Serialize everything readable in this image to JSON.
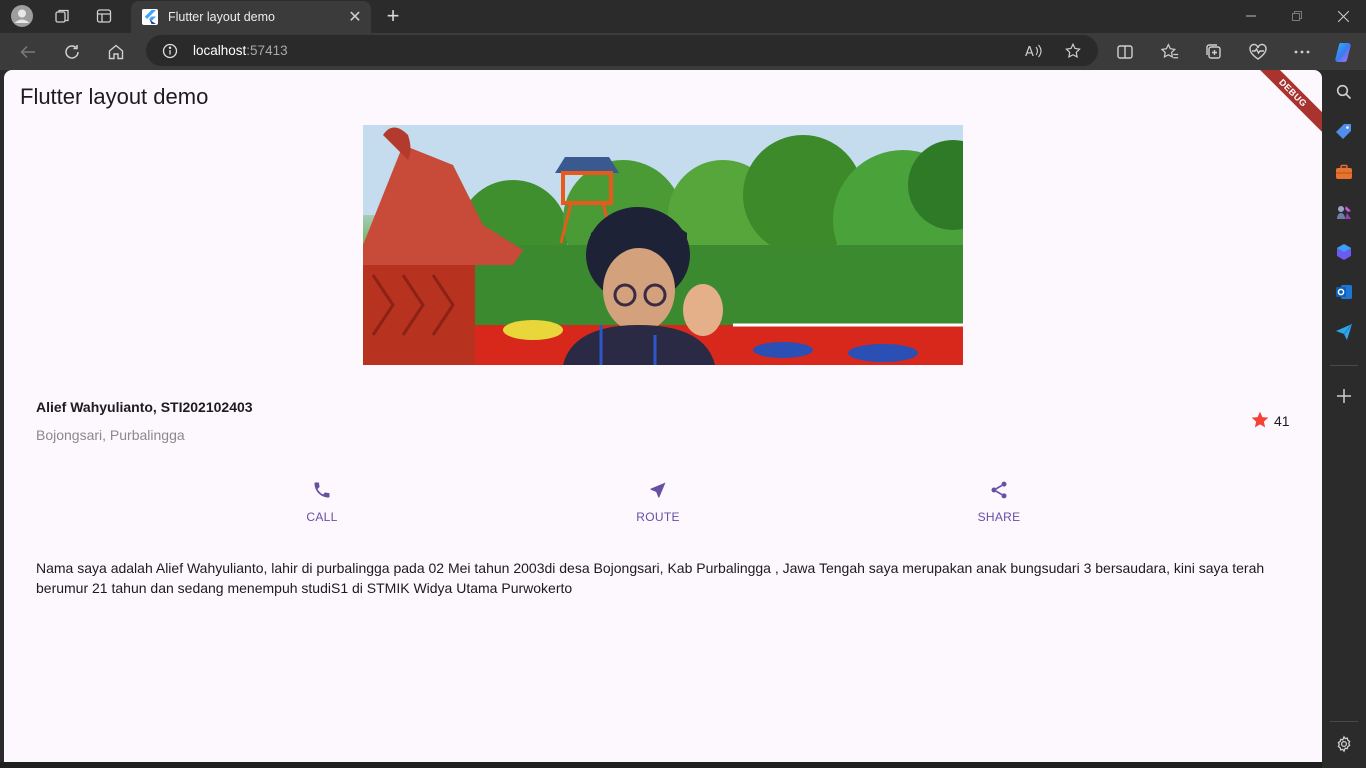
{
  "browser": {
    "tab_title": "Flutter layout demo",
    "url_host": "localhost",
    "url_port": ":57413",
    "accent_color": "#6750a4"
  },
  "app": {
    "title": "Flutter layout demo",
    "debug_label": "DEBUG",
    "name": "Alief Wahyulianto, STI202102403",
    "location": "Bojongsari, Purbalingga",
    "star_count": "41",
    "actions": [
      {
        "label": "CALL",
        "icon": "phone-icon"
      },
      {
        "label": "ROUTE",
        "icon": "near-me-icon"
      },
      {
        "label": "SHARE",
        "icon": "share-icon"
      }
    ],
    "description": "Nama saya adalah Alief Wahyulianto, lahir di purbalingga pada 02 Mei tahun 2003di desa Bojongsari, Kab Purbalingga , Jawa Tengah saya merupakan anak bungsudari 3 bersaudara, kini saya terah berumur 21 tahun dan sedang menempuh studiS1 di STMIK Widya Utama Purwokerto"
  }
}
